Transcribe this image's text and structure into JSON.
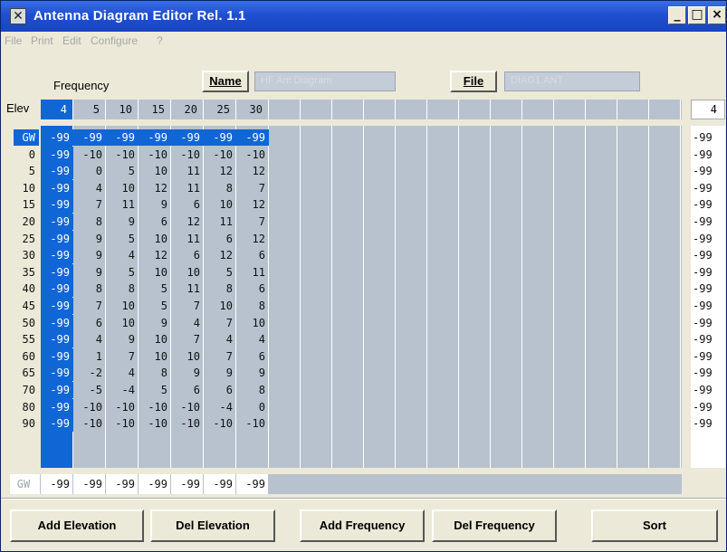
{
  "window": {
    "title": "Antenna Diagram Editor Rel. 1.1",
    "minimize": "_",
    "maximize": "□",
    "close": "×"
  },
  "menu": [
    "File",
    "Print",
    "Edit",
    "Configure",
    "?"
  ],
  "labels": {
    "frequency": "Frequency",
    "elev": "Elev",
    "name_button": "Name",
    "file_button": "File"
  },
  "fields": {
    "name_value": "HF Ant Diagram",
    "file_value": "DIAG1.ANT"
  },
  "frequencies": [
    "4",
    "5",
    "10",
    "15",
    "20",
    "25",
    "30"
  ],
  "selected_frequency_readout": "4",
  "elevations": [
    "GW",
    "0",
    "5",
    "10",
    "15",
    "20",
    "25",
    "30",
    "35",
    "40",
    "45",
    "50",
    "55",
    "60",
    "65",
    "70",
    "80",
    "90"
  ],
  "rows": [
    [
      "-99",
      "-99",
      "-99",
      "-99",
      "-99",
      "-99",
      "-99"
    ],
    [
      "-99",
      "-10",
      "-10",
      "-10",
      "-10",
      "-10",
      "-10"
    ],
    [
      "-99",
      "0",
      "5",
      "10",
      "11",
      "12",
      "12"
    ],
    [
      "-99",
      "4",
      "10",
      "12",
      "11",
      "8",
      "7"
    ],
    [
      "-99",
      "7",
      "11",
      "9",
      "6",
      "10",
      "12"
    ],
    [
      "-99",
      "8",
      "9",
      "6",
      "12",
      "11",
      "7"
    ],
    [
      "-99",
      "9",
      "5",
      "10",
      "11",
      "6",
      "12"
    ],
    [
      "-99",
      "9",
      "4",
      "12",
      "6",
      "12",
      "6"
    ],
    [
      "-99",
      "9",
      "5",
      "10",
      "10",
      "5",
      "11"
    ],
    [
      "-99",
      "8",
      "8",
      "5",
      "11",
      "8",
      "6"
    ],
    [
      "-99",
      "7",
      "10",
      "5",
      "7",
      "10",
      "8"
    ],
    [
      "-99",
      "6",
      "10",
      "9",
      "4",
      "7",
      "10"
    ],
    [
      "-99",
      "4",
      "9",
      "10",
      "7",
      "4",
      "4"
    ],
    [
      "-99",
      "1",
      "7",
      "10",
      "10",
      "7",
      "6"
    ],
    [
      "-99",
      "-2",
      "4",
      "8",
      "9",
      "9",
      "9"
    ],
    [
      "-99",
      "-5",
      "-4",
      "5",
      "6",
      "6",
      "8"
    ],
    [
      "-99",
      "-10",
      "-10",
      "-10",
      "-10",
      "-4",
      "0"
    ],
    [
      "-99",
      "-10",
      "-10",
      "-10",
      "-10",
      "-10",
      "-10"
    ]
  ],
  "right_column": [
    "-99",
    "-99",
    "-99",
    "-99",
    "-99",
    "-99",
    "-99",
    "-99",
    "-99",
    "-99",
    "-99",
    "-99",
    "-99",
    "-99",
    "-99",
    "-99",
    "-99",
    "-99"
  ],
  "footer": {
    "label": "GW",
    "values": [
      "-99",
      "-99",
      "-99",
      "-99",
      "-99",
      "-99",
      "-99"
    ]
  },
  "buttons": {
    "add_elevation": "Add Elevation",
    "del_elevation": "Del Elevation",
    "add_frequency": "Add Frequency",
    "del_frequency": "Del Frequency",
    "sort": "Sort"
  },
  "colors": {
    "titlebar": "#1f4fd0",
    "selection": "#1166d6",
    "grid": "#b7c2ce"
  }
}
